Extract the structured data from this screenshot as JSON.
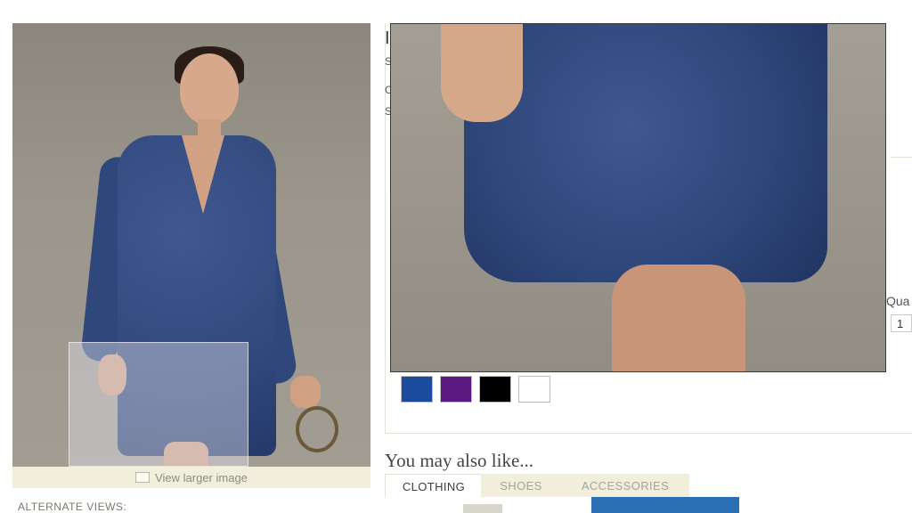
{
  "product": {
    "title_fragment": "I",
    "fragments": [
      "S",
      "C",
      "S"
    ],
    "swatches": [
      {
        "name": "blue",
        "color": "#1a4a9c"
      },
      {
        "name": "purple",
        "color": "#5b1a82"
      },
      {
        "name": "black",
        "color": "#000000"
      },
      {
        "name": "white",
        "color": "#ffffff"
      }
    ],
    "quantity_label": "Qua",
    "quantity_value": "1"
  },
  "image": {
    "view_larger_label": "View larger image",
    "alternate_views_label": "ALTERNATE VIEWS:"
  },
  "recommendations": {
    "heading": "You may also like...",
    "tabs": [
      {
        "label": "CLOTHING",
        "active": true
      },
      {
        "label": "SHOES",
        "active": false
      },
      {
        "label": "ACCESSORIES",
        "active": false
      }
    ]
  }
}
